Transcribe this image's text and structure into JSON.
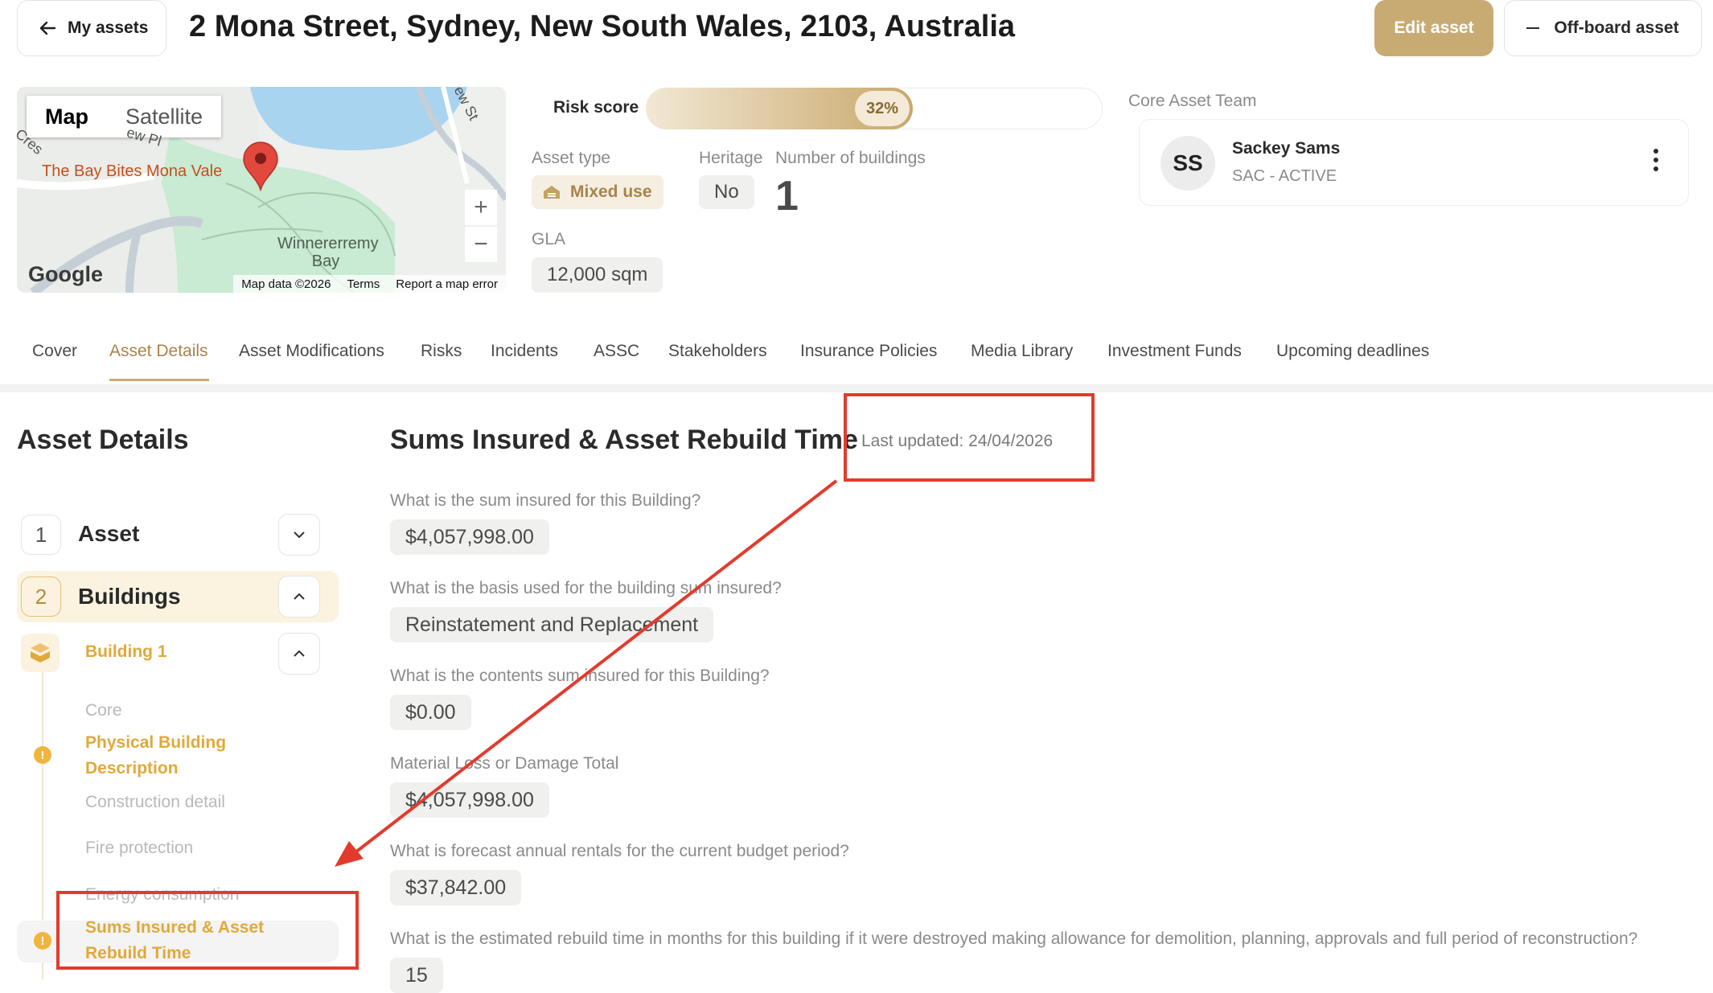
{
  "header": {
    "back_label": "My assets",
    "title": "2 Mona Street, Sydney, New South Wales, 2103, Australia",
    "edit_label": "Edit asset",
    "offboard_label": "Off-board asset"
  },
  "map": {
    "map_tab": "Map",
    "satellite_tab": "Satellite",
    "poi_label": "The Bay Bites Mona Vale",
    "bay_label": "Winnererremy Bay",
    "street_label_1": "ew Pl",
    "street_label_2": "ew St",
    "street_label_3": "Cres",
    "zoom_in": "+",
    "zoom_out": "−",
    "logo": "Google",
    "map_data": "Map data ©2026",
    "terms": "Terms",
    "report": "Report a map error"
  },
  "summary": {
    "risk_label": "Risk score",
    "risk_value": "32%",
    "risk_fraction": 0.32,
    "asset_type_label": "Asset type",
    "asset_type_value": "Mixed use",
    "heritage_label": "Heritage",
    "heritage_value": "No",
    "buildings_label": "Number of buildings",
    "buildings_value": "1",
    "gla_label": "GLA",
    "gla_value": "12,000 sqm"
  },
  "team": {
    "heading": "Core Asset Team",
    "initials": "SS",
    "name": "Sackey Sams",
    "role": "SAC - ACTIVE"
  },
  "tabs": [
    {
      "label": "Cover"
    },
    {
      "label": "Asset Details"
    },
    {
      "label": "Asset Modifications"
    },
    {
      "label": "Risks"
    },
    {
      "label": "Incidents"
    },
    {
      "label": "ASSC"
    },
    {
      "label": "Stakeholders"
    },
    {
      "label": "Insurance Policies"
    },
    {
      "label": "Media Library"
    },
    {
      "label": "Investment Funds"
    },
    {
      "label": "Upcoming deadlines"
    }
  ],
  "nav": {
    "title": "Asset Details",
    "items": [
      {
        "num": "1",
        "label": "Asset"
      },
      {
        "num": "2",
        "label": "Buildings"
      }
    ],
    "building_label": "Building 1",
    "sub_items": [
      "Core",
      "Physical Building Description",
      "Construction detail",
      "Fire protection",
      "Energy consumption",
      "Sums Insured & Asset Rebuild Time"
    ]
  },
  "form": {
    "title": "Sums Insured & Asset Rebuild Time",
    "last_updated": "Last updated: 24/04/2026",
    "questions": [
      {
        "q": "What is the sum insured for this Building?",
        "a": "$4,057,998.00"
      },
      {
        "q": "What is the basis used for the building sum insured?",
        "a": "Reinstatement and Replacement"
      },
      {
        "q": "What is the contents sum insured for this Building?",
        "a": "$0.00"
      },
      {
        "q": "Material Loss or Damage Total",
        "a": "$4,057,998.00"
      },
      {
        "q": "What is forecast annual rentals for the current budget period?",
        "a": "$37,842.00"
      },
      {
        "q": "What is the estimated rebuild time in months for this building if it were destroyed making allowance for demolition, planning, approvals and full period of reconstruction?",
        "a": "15"
      }
    ]
  },
  "colors": {
    "accent": "#c8ab73",
    "warning": "#f0b53f",
    "annotation": "#e23b2e"
  }
}
